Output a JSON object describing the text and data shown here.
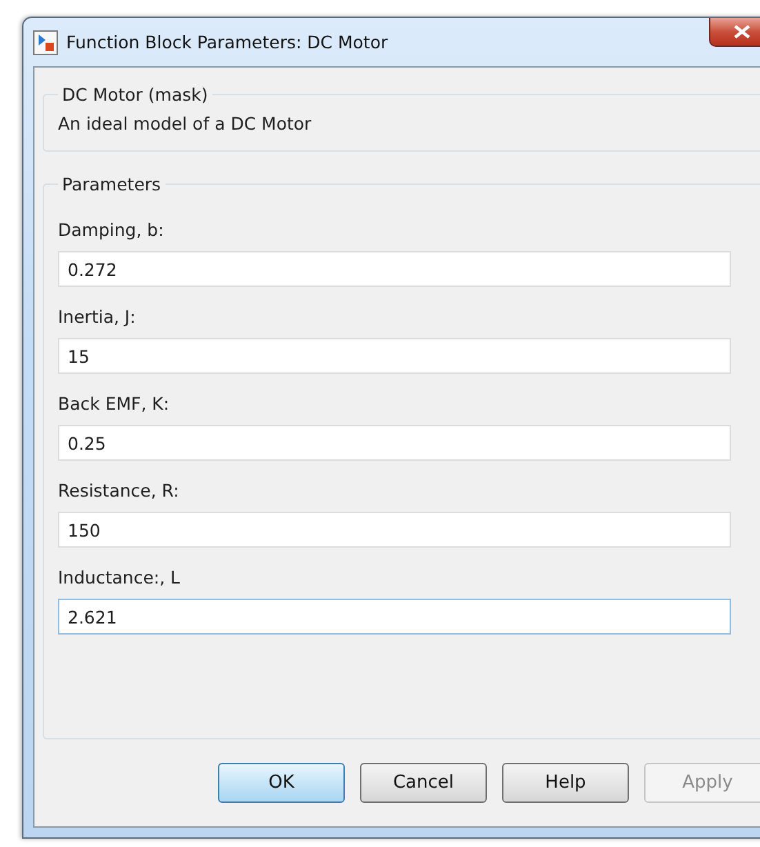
{
  "window": {
    "title": "Function Block Parameters: DC Motor"
  },
  "mask": {
    "title": "DC Motor (mask)",
    "description": "An ideal model of a DC Motor"
  },
  "parameters": {
    "title": "Parameters",
    "fields": [
      {
        "label": "Damping, b:",
        "value": "0.272",
        "focused": false
      },
      {
        "label": "Inertia, J:",
        "value": "15",
        "focused": false
      },
      {
        "label": "Back EMF, K:",
        "value": "0.25",
        "focused": false
      },
      {
        "label": "Resistance, R:",
        "value": "150",
        "focused": false
      },
      {
        "label": "Inductance:, L",
        "value": "2.621",
        "focused": true
      }
    ]
  },
  "buttons": [
    {
      "label": "OK",
      "default": true,
      "disabled": false
    },
    {
      "label": "Cancel",
      "default": false,
      "disabled": false
    },
    {
      "label": "Help",
      "default": false,
      "disabled": false
    },
    {
      "label": "Apply",
      "default": false,
      "disabled": true
    }
  ]
}
